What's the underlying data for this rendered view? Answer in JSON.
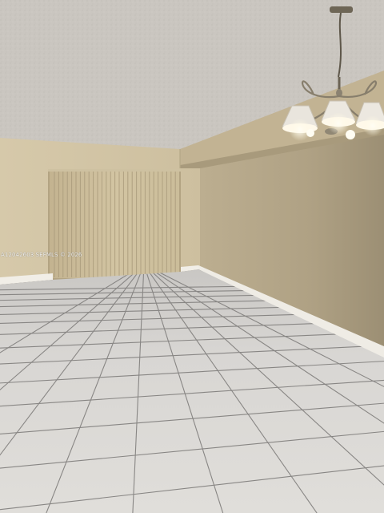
{
  "photo": {
    "watermark": "A12042603 SEFMLS © 2026"
  },
  "colors": {
    "ceiling": "#cdc9c3",
    "wall_back": "#d2c5a6",
    "wall_right": "#b2a488",
    "soffit": "#c4b595",
    "curtain": "#cebf9c",
    "floor_tile": "#d8d6d3",
    "grout": "#7c7a78",
    "baseboard": "#f2efe8",
    "lamp_glow": "#fffbef"
  },
  "icons": {
    "fixture": "chandelier-icon"
  }
}
